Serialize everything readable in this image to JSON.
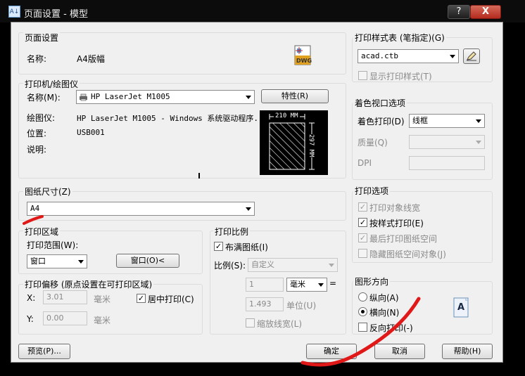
{
  "window": {
    "title": "页面设置 - 模型",
    "app_icon": "A↓",
    "help": "?",
    "close": "X"
  },
  "page_setup": {
    "group": "页面设置",
    "name_label": "名称:",
    "name_value": "A4版幅",
    "dwg_icon_text": "DWG"
  },
  "printer": {
    "group": "打印机/绘图仪",
    "name_label": "名称(M):",
    "name_value": "HP LaserJet M1005",
    "properties_button": "特性(R)",
    "plotter_label": "绘图仪:",
    "plotter_value": "HP LaserJet M1005 - Windows 系统驱动程序...",
    "location_label": "位置:",
    "location_value": "USB001",
    "desc_label": "说明:",
    "preview": {
      "width_label": "210 MM",
      "height_label": "297 MM"
    }
  },
  "paper_size": {
    "group": "图纸尺寸(Z)",
    "value": "A4"
  },
  "plot_area": {
    "group": "打印区域",
    "range_label": "打印范围(W):",
    "range_value": "窗口",
    "window_button": "窗口(O)<"
  },
  "plot_offset": {
    "group": "打印偏移 (原点设置在可打印区域)",
    "x_label": "X:",
    "x_value": "3.01",
    "x_unit": "毫米",
    "y_label": "Y:",
    "y_value": "0.00",
    "y_unit": "毫米",
    "center_label": "居中打印(C)"
  },
  "plot_scale": {
    "group": "打印比例",
    "fit_label": "布满图纸(I)",
    "scale_label": "比例(S):",
    "scale_value": "自定义",
    "value1": "1",
    "unit_value": "毫米",
    "equals": "=",
    "value2": "1.493",
    "unit_label": "单位(U)",
    "lineweight_label": "缩放线宽(L)"
  },
  "plot_style": {
    "group": "打印样式表 (笔指定)(G)",
    "value": "acad.ctb",
    "display_label": "显示打印样式(T)"
  },
  "shaded_viewport": {
    "group": "着色视口选项",
    "shade_label": "着色打印(D)",
    "shade_value": "线框",
    "quality_label": "质量(Q)",
    "dpi_label": "DPI"
  },
  "plot_options": {
    "group": "打印选项",
    "opt1": "打印对象线宽",
    "opt2": "按样式打印(E)",
    "opt3": "最后打印图纸空间",
    "opt4": "隐藏图纸空间对象(J)"
  },
  "orientation": {
    "group": "图形方向",
    "portrait": "纵向(A)",
    "landscape": "横向(N)",
    "reverse": "反向打印(-)",
    "icon_text": "A"
  },
  "buttons": {
    "preview": "预览(P)...",
    "ok": "确定",
    "cancel": "取消",
    "help": "帮助(H)"
  }
}
